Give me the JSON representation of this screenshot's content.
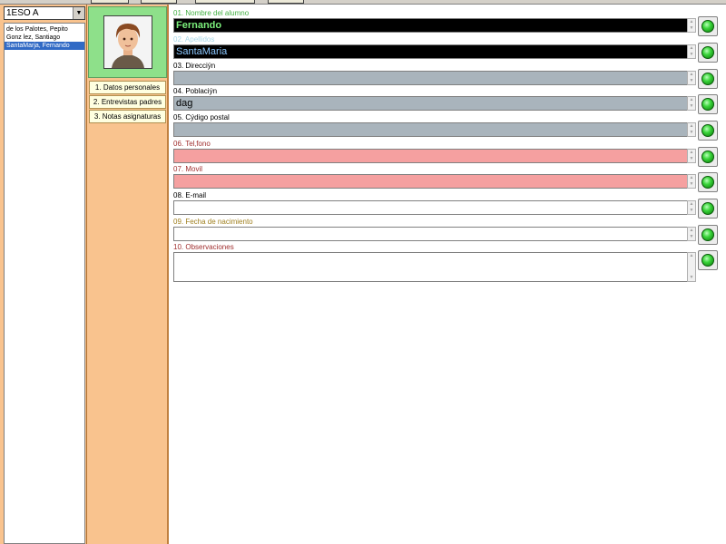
{
  "group": {
    "selected": "1ESO A"
  },
  "students": [
    {
      "name": "de los Palotes, Pepito",
      "selected": false
    },
    {
      "name": "Gonz lez, Santiago",
      "selected": false
    },
    {
      "name": "SantaMarja, Fernando",
      "selected": true
    }
  ],
  "tabs": [
    {
      "label": "1. Datos personales"
    },
    {
      "label": "2. Entrevistas padres"
    },
    {
      "label": "3. Notas asignaturas"
    }
  ],
  "fields": [
    {
      "label": "01. Nombre del alumno",
      "value": "Fernando",
      "label_color": "#44b044",
      "bg": "#000000",
      "fg": "#7cf07c",
      "bold": true
    },
    {
      "label": "02. Apellidos",
      "value": "SantaMaria",
      "label_color": "#a8d8e8",
      "bg": "#000000",
      "fg": "#8cc8ff",
      "bold": false
    },
    {
      "label": "03. Direcciýn",
      "value": "",
      "label_color": "#000000",
      "bg": "#a9b4bc",
      "fg": "#000000",
      "bold": false
    },
    {
      "label": "04. Poblaciýn",
      "value": "dag",
      "label_color": "#000000",
      "bg": "#a9b4bc",
      "fg": "#000000",
      "bold": false
    },
    {
      "label": "05. Cýdigo postal",
      "value": "",
      "label_color": "#000000",
      "bg": "#a9b4bc",
      "fg": "#000000",
      "bold": false
    },
    {
      "label": "06. Tel‚fono",
      "value": "",
      "label_color": "#a03030",
      "bg": "#f5a0a0",
      "fg": "#000000",
      "bold": false
    },
    {
      "label": "07. Movil",
      "value": "",
      "label_color": "#a03030",
      "bg": "#f5a0a0",
      "fg": "#000000",
      "bold": false
    },
    {
      "label": "08. E-mail",
      "value": "",
      "label_color": "#000000",
      "bg": "#ffffff",
      "fg": "#000000",
      "bold": false
    },
    {
      "label": "09. Fecha de nacimiento",
      "value": "",
      "label_color": "#a08020",
      "bg": "#ffffff",
      "fg": "#000000",
      "bold": false
    },
    {
      "label": "10. Observaciones",
      "value": "",
      "label_color": "#a03030",
      "bg": "#ffffff",
      "fg": "#000000",
      "bold": false
    }
  ],
  "icons": {
    "dropdown": "chevron-down-icon",
    "confirm": "green-led-icon",
    "photo": "student-avatar"
  },
  "colors": {
    "panel": "#f9c38e",
    "photo_frame": "#8ee08a",
    "selection": "#316ac5"
  }
}
